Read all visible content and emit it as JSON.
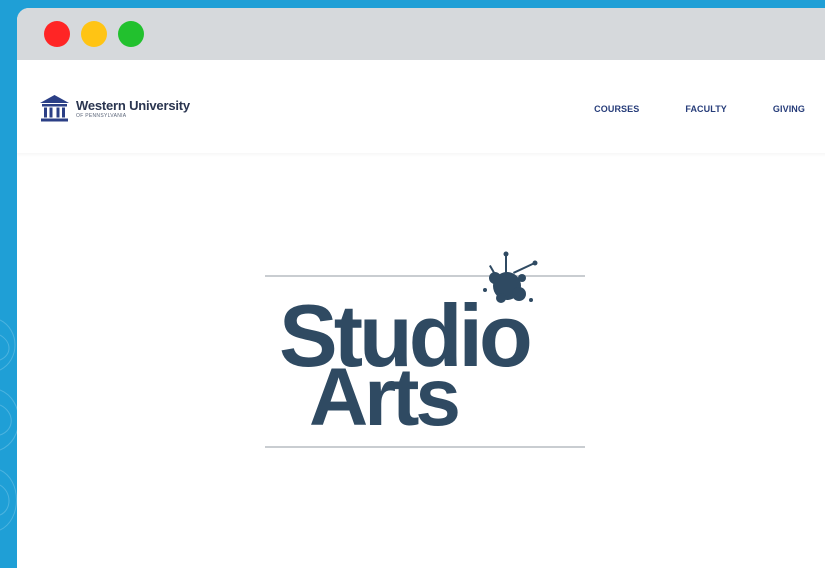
{
  "window": {
    "controls": [
      "close",
      "minimize",
      "maximize"
    ],
    "colors": {
      "close": "#ff2525",
      "minimize": "#ffc414",
      "maximize": "#22c12e"
    }
  },
  "header": {
    "logo": {
      "icon": "university-building-icon",
      "name": "Western University",
      "subtitle": "OF PENNSYLVANIA"
    },
    "nav": [
      {
        "label": "COURSES"
      },
      {
        "label": "FACULTY"
      },
      {
        "label": "GIVING"
      }
    ]
  },
  "hero": {
    "logo_line1": "Studio",
    "logo_line2": "Arts",
    "splat_icon": "paint-splatter-icon",
    "text_color": "#2f4a62"
  },
  "colors": {
    "background": "#1f9fd6",
    "titlebar": "#d6d9dc",
    "nav": "#273d7a"
  }
}
